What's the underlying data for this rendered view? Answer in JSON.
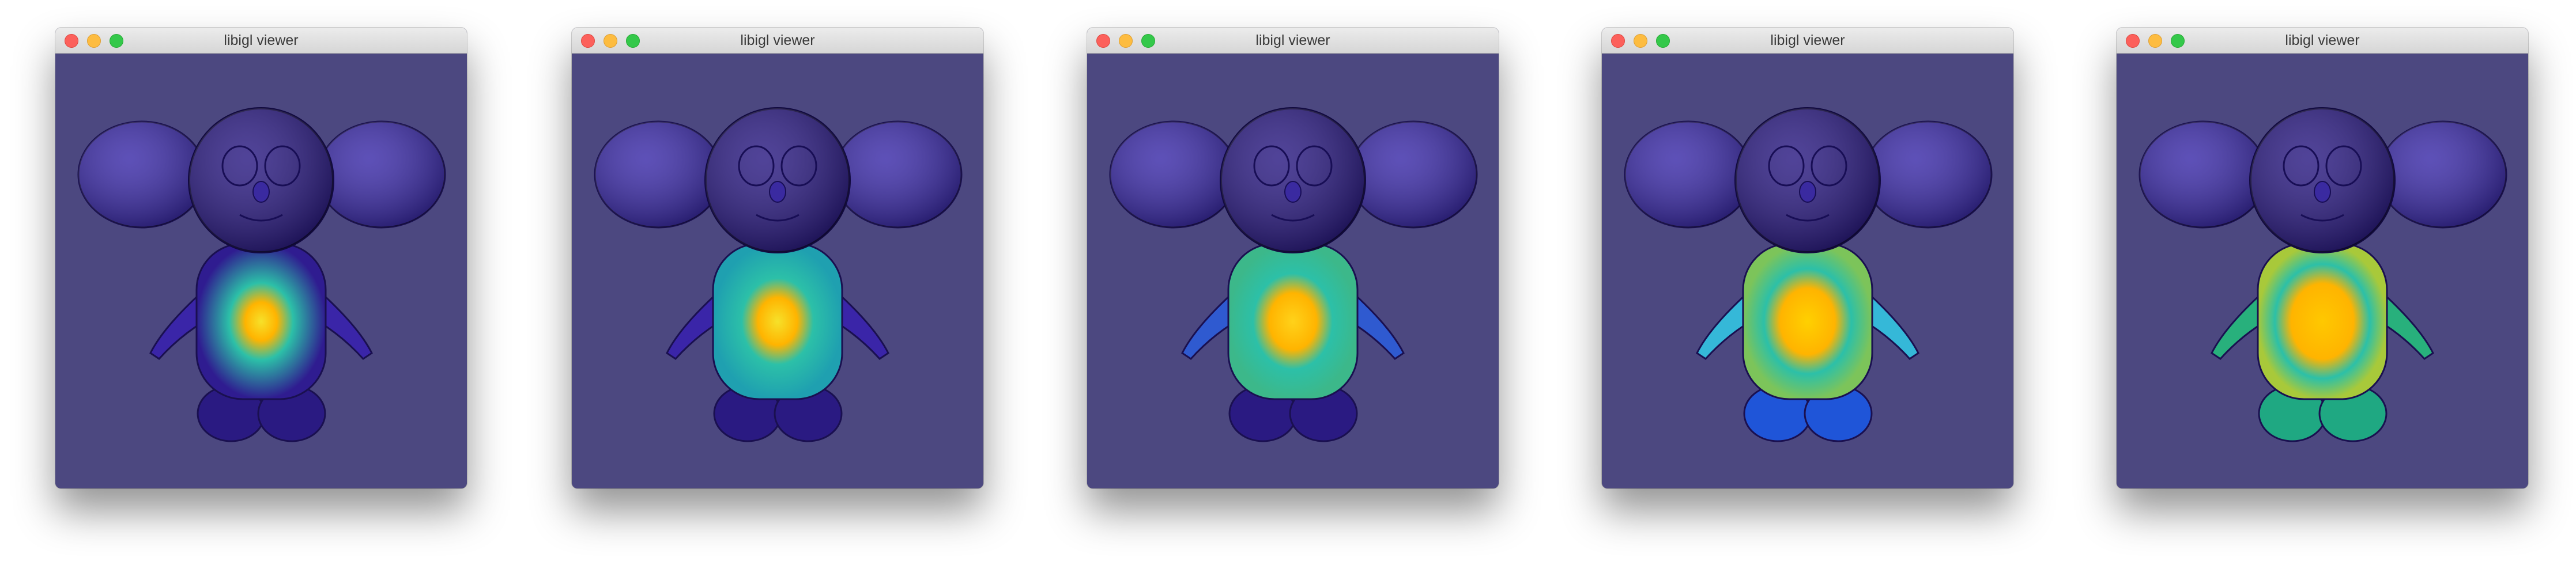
{
  "windows": [
    {
      "title": "libigl viewer",
      "heat_level": 0.15,
      "colors": {
        "head": "#2a1a82",
        "ears": "#3a2aa8",
        "torso": "#2f1c90",
        "arms": "#3a25a8",
        "feet": "#2a1a82",
        "center": "#f6e12a"
      }
    },
    {
      "title": "libigl viewer",
      "heat_level": 0.35,
      "colors": {
        "head": "#2a1a82",
        "ears": "#3a2aa8",
        "torso": "#1fa0b0",
        "arms": "#3a25a8",
        "feet": "#2a1a82",
        "center": "#f6e12a"
      }
    },
    {
      "title": "libigl viewer",
      "heat_level": 0.55,
      "colors": {
        "head": "#2a1a82",
        "ears": "#3a2aa8",
        "torso": "#3cb88a",
        "arms": "#2f5ad0",
        "feet": "#2a1a82",
        "center": "#ffd21a"
      }
    },
    {
      "title": "libigl viewer",
      "heat_level": 0.75,
      "colors": {
        "head": "#2a1a82",
        "ears": "#3a2aa8",
        "torso": "#7cc45a",
        "arms": "#35b8d8",
        "feet": "#1f55d8",
        "center": "#ffd000"
      }
    },
    {
      "title": "libigl viewer",
      "heat_level": 0.95,
      "colors": {
        "head": "#2a1a82",
        "ears": "#3a2aa8",
        "torso": "#a8c93a",
        "arms": "#28b07c",
        "feet": "#1fa882",
        "center": "#ffc800"
      }
    }
  ],
  "viewport_background": "#4c4880"
}
